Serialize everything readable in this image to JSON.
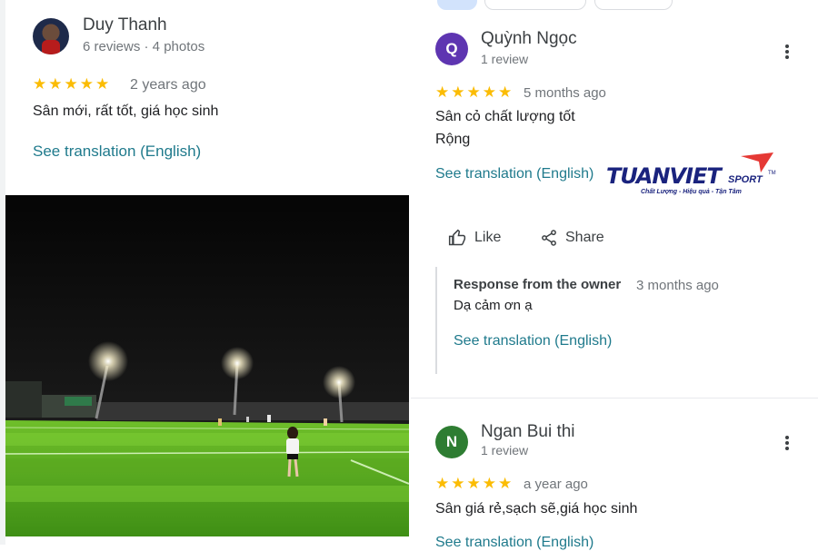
{
  "left_review": {
    "author": "Duy Thanh",
    "meta": "6 reviews · 4 photos",
    "stars": "★★★★★",
    "date": "2 years ago",
    "text": "Sân mới, rất tốt, giá học sinh",
    "translate": "See translation (English)",
    "photo_icon": "football-field-night-photo"
  },
  "right_reviews": [
    {
      "avatar_letter": "Q",
      "avatar_color": "#5e35b1",
      "author": "Quỳnh Ngọc",
      "meta": "1 review",
      "stars": "★★★★★",
      "date": "5 months ago",
      "text_line1": "Sân cỏ chất lượng tốt",
      "text_line2": "Rộng",
      "translate": "See translation (English)",
      "like_label": "Like",
      "share_label": "Share",
      "owner_response": {
        "title": "Response from the owner",
        "date": "3 months ago",
        "text": "Dạ cảm ơn ạ",
        "translate": "See translation (English)"
      }
    },
    {
      "avatar_letter": "N",
      "avatar_color": "#2e7d32",
      "author": "Ngan Bui thi",
      "meta": "1 review",
      "stars": "★★★★★",
      "date": "a year ago",
      "text": "Sân giá rẻ,sạch sẽ,giá học sinh",
      "translate": "See translation (English)"
    }
  ],
  "watermark": {
    "brand": "TUANVIET",
    "suffix": "SPORT",
    "tm": "TM",
    "tagline": "Chất Lượng - Hiệu quả - Tận Tâm",
    "brand_color": "#1a237e",
    "accent_color": "#e53935"
  }
}
